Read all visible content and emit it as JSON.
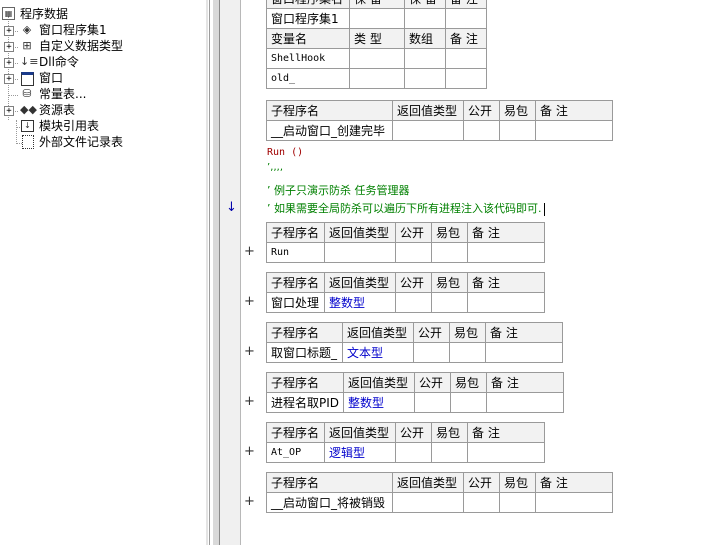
{
  "tree": {
    "root": "程序数据",
    "items": [
      {
        "label": "窗口程序集1",
        "icon": "assembly-icon",
        "expander": "+"
      },
      {
        "label": "自定义数据类型",
        "icon": "datatype-icon",
        "expander": "+"
      },
      {
        "label": "Dll命令",
        "icon": "dll-icon",
        "expander": "+"
      },
      {
        "label": "窗口",
        "icon": "window-icon",
        "expander": "+"
      },
      {
        "label": "常量表...",
        "icon": "constant-icon",
        "expander": ""
      },
      {
        "label": "资源表",
        "icon": "resource-icon",
        "expander": "+"
      },
      {
        "label": "模块引用表",
        "icon": "module-icon",
        "expander": ""
      },
      {
        "label": "外部文件记录表",
        "icon": "file-icon",
        "expander": ""
      }
    ]
  },
  "assembly_table": {
    "headers": [
      "窗口程序集名",
      "保 留",
      "保 留",
      "备 注"
    ],
    "row": [
      "窗口程序集1",
      "",
      "",
      ""
    ],
    "var_headers": [
      "变量名",
      "类 型",
      "数组",
      "备 注"
    ],
    "vars": [
      [
        "ShellHook",
        "",
        "",
        ""
      ],
      [
        "old_",
        "",
        "",
        ""
      ]
    ]
  },
  "sub_headers": [
    "子程序名",
    "返回值类型",
    "公开",
    "易包",
    "备 注"
  ],
  "subs": [
    {
      "name": "__启动窗口_创建完毕",
      "ret": ""
    },
    {
      "name": "Run",
      "ret": ""
    },
    {
      "name": "窗口处理",
      "ret": "整数型"
    },
    {
      "name": "取窗口标题_",
      "ret": "文本型"
    },
    {
      "name": "进程名取PID",
      "ret": "整数型"
    },
    {
      "name": "At_OP",
      "ret": "逻辑型"
    },
    {
      "name": "__启动窗口_将被销毁",
      "ret": ""
    }
  ],
  "code": {
    "line1": "Run ()",
    "line2": "’‚‚‚‚",
    "line3": "’ 例子只演示防杀 任务管理器",
    "line4": "’ 如果需要全局防杀可以遍历下所有进程注入该代码即可."
  },
  "gutter": {
    "plus": "+",
    "arrow": "↓"
  }
}
